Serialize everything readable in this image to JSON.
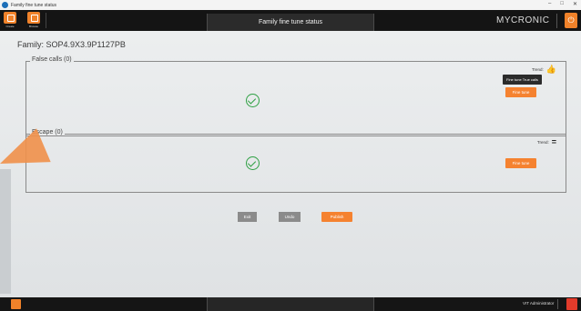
{
  "os_window": {
    "title": "Family fine tune status",
    "controls": [
      "–",
      "□",
      "✕"
    ]
  },
  "header": {
    "buttons": [
      {
        "label": "Create",
        "icon": "create-icon"
      },
      {
        "label": "Browse",
        "icon": "browse-icon"
      }
    ],
    "title": "Family fine tune status",
    "brand": "MYCRONIC",
    "power_icon": "power-icon"
  },
  "family": {
    "title": "Family: SOP4.9X3.9P1127PB"
  },
  "false_calls": {
    "legend": "False calls (0)",
    "trend_label": "Trend:",
    "trend_icon": "thumbs-up-icon",
    "tooltip": "Fine tune True calls",
    "button_label": "Fine tune",
    "status_icon": "check-circle-icon"
  },
  "escape": {
    "legend": "Escape (0)",
    "trend_label": "Trend:",
    "trend_icon": "equals-icon",
    "button_label": "Fine tune",
    "status_icon": "check-circle-icon"
  },
  "actions": {
    "exit": "Exit",
    "undo": "Undo",
    "publish": "Publish"
  },
  "footer": {
    "user": "VIT Administrator"
  },
  "colors": {
    "accent": "#f58230",
    "success": "#2ea043",
    "header_bg": "#141414",
    "gray_button": "#8b8b8b"
  }
}
